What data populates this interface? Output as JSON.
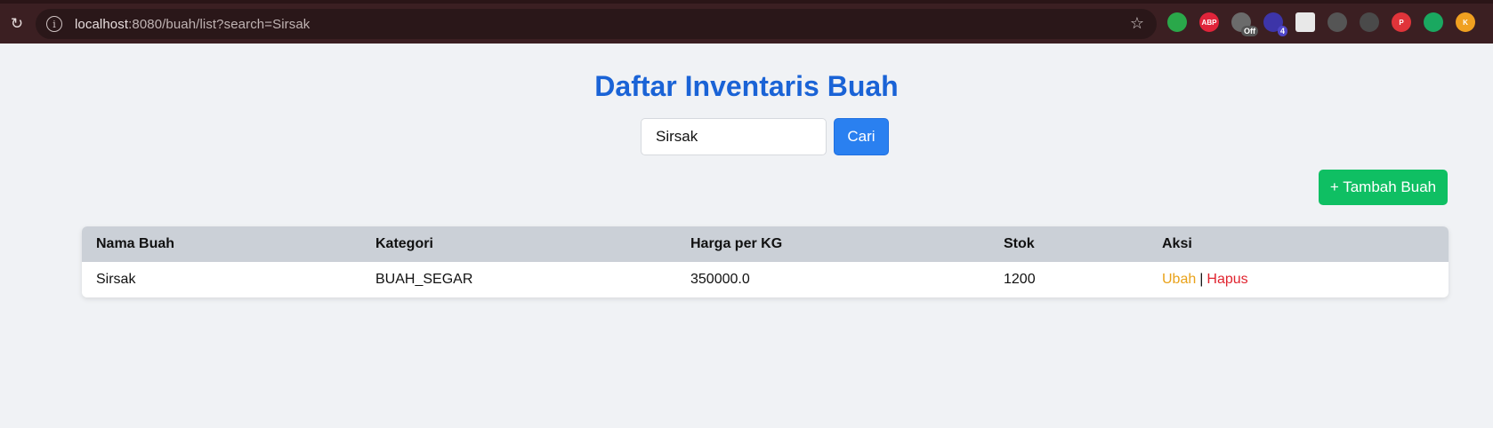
{
  "browser": {
    "url_host": "localhost",
    "url_rest": ":8080/buah/list?search=Sirsak",
    "extensions": [
      {
        "name": "robot-extension-icon",
        "color": "#2aa84a",
        "label": ""
      },
      {
        "name": "adblock-icon",
        "color": "#e0243a",
        "label": "ABP"
      },
      {
        "name": "extension-off-icon",
        "color": "#6b6b6b",
        "label": "",
        "badge": "Off"
      },
      {
        "name": "extension-count-icon",
        "color": "#3d35a8",
        "label": "",
        "badge": "4"
      },
      {
        "name": "terminal-icon",
        "color": "#e8e8e8",
        "label": ""
      },
      {
        "name": "target-icon",
        "color": "#555",
        "label": ""
      },
      {
        "name": "ghost-icon",
        "color": "#4a4a4a",
        "label": ""
      },
      {
        "name": "p-extension-icon",
        "color": "#e0343a",
        "label": "P"
      },
      {
        "name": "leaf-icon",
        "color": "#1aa860",
        "label": ""
      },
      {
        "name": "k-extension-icon",
        "color": "#f0a020",
        "label": "K"
      }
    ]
  },
  "page": {
    "title": "Daftar Inventaris Buah",
    "search": {
      "value": "Sirsak",
      "button_label": "Cari"
    },
    "add_button_label": "+ Tambah Buah"
  },
  "table": {
    "headers": [
      "Nama Buah",
      "Kategori",
      "Harga per KG",
      "Stok",
      "Aksi"
    ],
    "rows": [
      {
        "nama": "Sirsak",
        "kategori": "BUAH_SEGAR",
        "harga": "350000.0",
        "stok": "1200",
        "edit_label": "Ubah",
        "separator": "|",
        "delete_label": "Hapus"
      }
    ]
  },
  "colors": {
    "title": "#1a63d6",
    "search_button": "#2a80f0",
    "add_button": "#0fbf63",
    "edit_link": "#e9a21a",
    "delete_link": "#e0242f",
    "table_header": "#cbd0d7"
  }
}
